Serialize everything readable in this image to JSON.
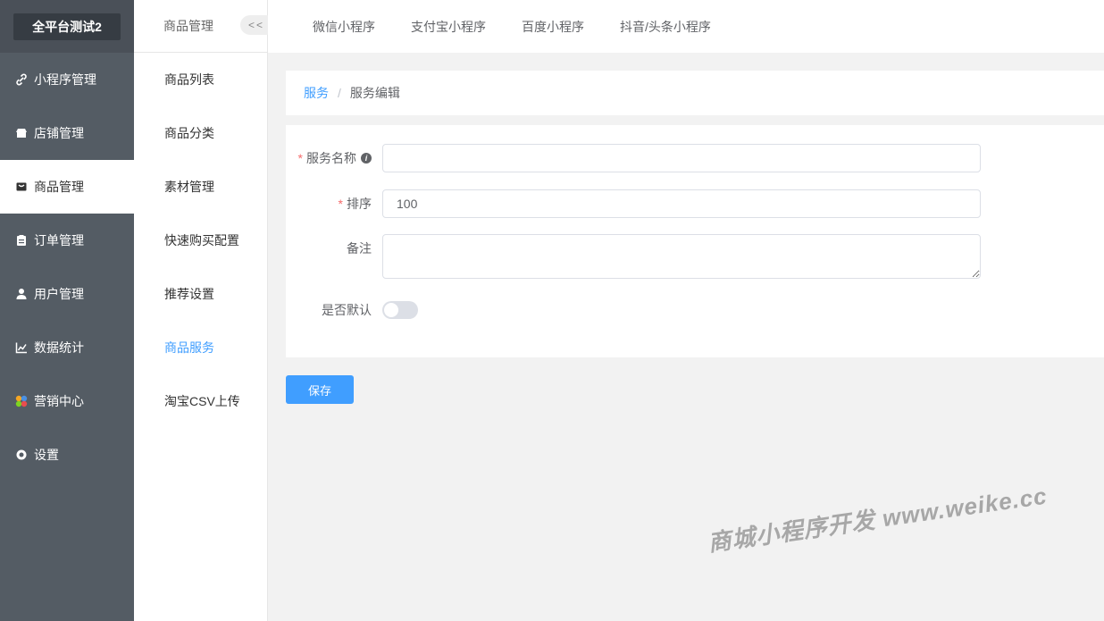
{
  "brand": {
    "name": "全平台测试2"
  },
  "sidebar": {
    "items": [
      {
        "label": "小程序管理",
        "icon": "link-icon"
      },
      {
        "label": "店铺管理",
        "icon": "store-icon"
      },
      {
        "label": "商品管理",
        "icon": "bag-icon",
        "active": true
      },
      {
        "label": "订单管理",
        "icon": "clipboard-icon"
      },
      {
        "label": "用户管理",
        "icon": "user-icon"
      },
      {
        "label": "数据统计",
        "icon": "chart-icon"
      },
      {
        "label": "营销中心",
        "icon": "marketing-icon"
      },
      {
        "label": "设置",
        "icon": "gear-icon"
      }
    ]
  },
  "subnav": {
    "title": "商品管理",
    "collapse_label": "<<",
    "items": [
      {
        "label": "商品列表"
      },
      {
        "label": "商品分类"
      },
      {
        "label": "素材管理"
      },
      {
        "label": "快速购买配置"
      },
      {
        "label": "推荐设置"
      },
      {
        "label": "商品服务",
        "active": true
      },
      {
        "label": "淘宝CSV上传"
      }
    ]
  },
  "top_tabs": [
    "微信小程序",
    "支付宝小程序",
    "百度小程序",
    "抖音/头条小程序"
  ],
  "breadcrumb": {
    "parent": "服务",
    "separator": "/",
    "current": "服务编辑"
  },
  "form": {
    "name": {
      "label": "服务名称",
      "required": true,
      "value": ""
    },
    "sort": {
      "label": "排序",
      "required": true,
      "value": "100"
    },
    "remark": {
      "label": "备注",
      "value": ""
    },
    "is_default": {
      "label": "是否默认",
      "checked": false
    }
  },
  "save_label": "保存",
  "watermark": "商城小程序开发 www.weike.cc",
  "colors": {
    "accent": "#409eff",
    "sidebar": "#545c64",
    "required": "#f56c6c"
  }
}
